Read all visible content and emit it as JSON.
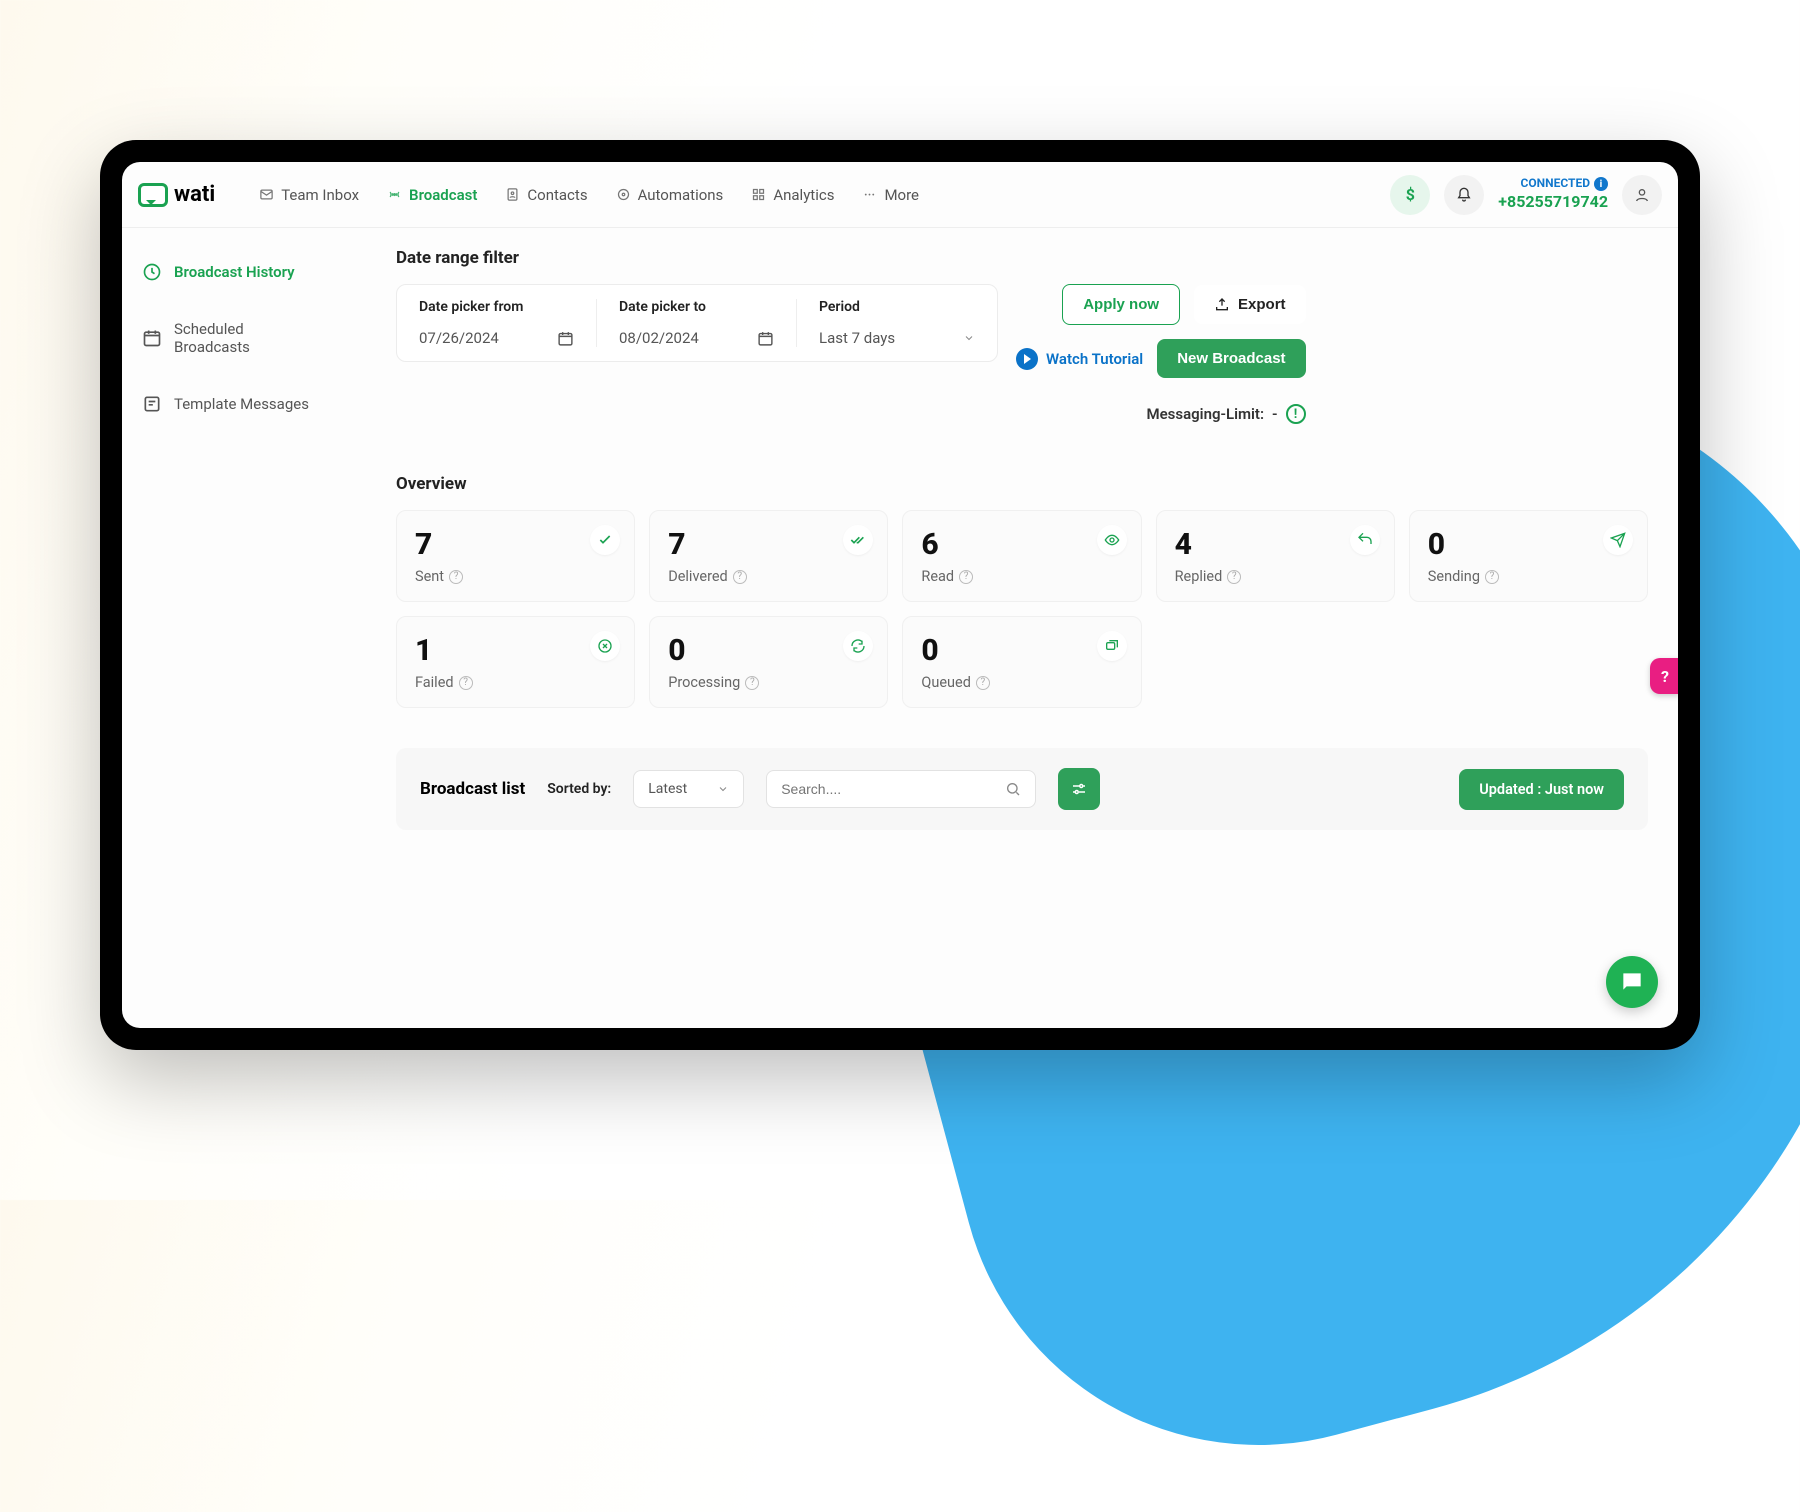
{
  "logo": "wati",
  "nav": [
    {
      "label": "Team Inbox"
    },
    {
      "label": "Broadcast"
    },
    {
      "label": "Contacts"
    },
    {
      "label": "Automations"
    },
    {
      "label": "Analytics"
    },
    {
      "label": "More"
    }
  ],
  "connected": {
    "label": "CONNECTED",
    "phone": "+85255719742"
  },
  "sidebar": [
    {
      "label": "Broadcast History"
    },
    {
      "label": "Scheduled Broadcasts"
    },
    {
      "label": "Template Messages"
    }
  ],
  "filter": {
    "title": "Date range filter",
    "from_label": "Date picker from",
    "from_value": "07/26/2024",
    "to_label": "Date picker to",
    "to_value": "08/02/2024",
    "period_label": "Period",
    "period_value": "Last 7 days",
    "apply": "Apply now",
    "export": "Export"
  },
  "actions": {
    "watch": "Watch Tutorial",
    "new": "New Broadcast",
    "msg_limit_label": "Messaging-Limit:",
    "msg_limit_value": "-"
  },
  "overview": {
    "title": "Overview",
    "stats": [
      {
        "num": "7",
        "label": "Sent"
      },
      {
        "num": "7",
        "label": "Delivered"
      },
      {
        "num": "6",
        "label": "Read"
      },
      {
        "num": "4",
        "label": "Replied"
      },
      {
        "num": "0",
        "label": "Sending"
      },
      {
        "num": "1",
        "label": "Failed"
      },
      {
        "num": "0",
        "label": "Processing"
      },
      {
        "num": "0",
        "label": "Queued"
      }
    ]
  },
  "list": {
    "title": "Broadcast list",
    "sorted_label": "Sorted by:",
    "sort_value": "Latest",
    "search_placeholder": "Search....",
    "updated": "Updated : Just now"
  },
  "help": "?"
}
